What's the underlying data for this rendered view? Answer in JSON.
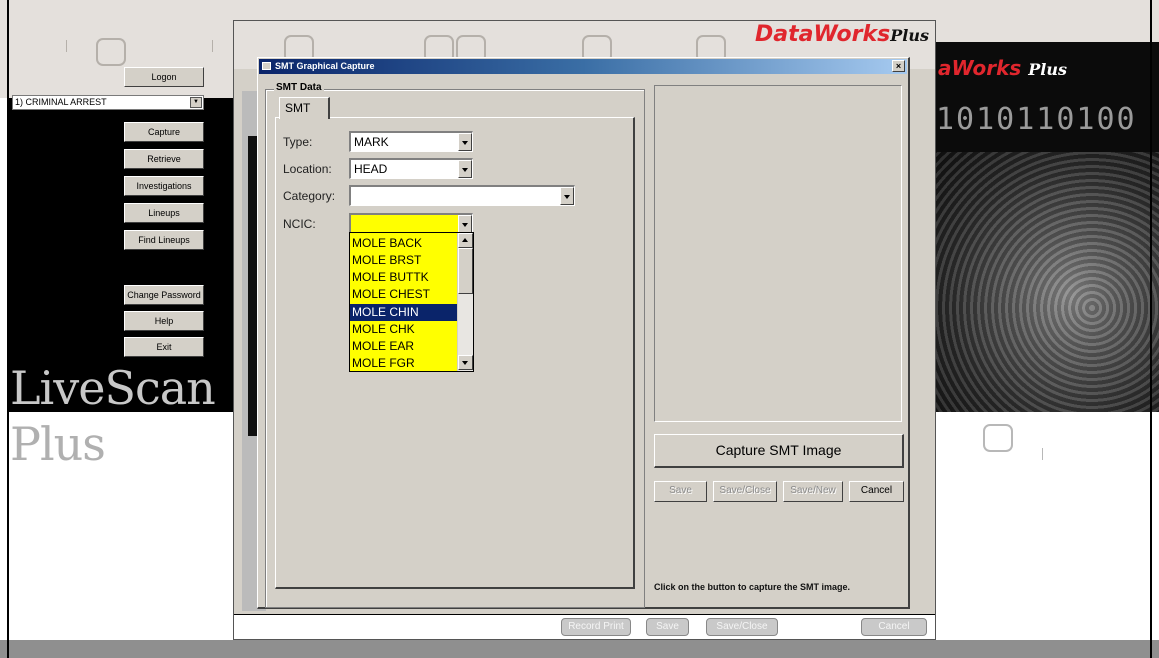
{
  "left_menu": {
    "logon": "Logon",
    "case_type": "1) CRIMINAL ARREST",
    "buttons": [
      "Capture",
      "Retrieve",
      "Investigations",
      "Lineups",
      "Find Lineups",
      "Change Password",
      "Help",
      "Exit"
    ]
  },
  "branding": {
    "livescan": "LiveScan",
    "plus": "Plus",
    "dataworks": "DataWorks",
    "dataworks_partial": "aWorks",
    "dataworks_plus": "Plus",
    "binary": "1010110100"
  },
  "bottom_bar": {
    "buttons": [
      "Record Print",
      "Save",
      "Save/Close",
      "Cancel"
    ]
  },
  "dialog": {
    "title": "SMT Graphical Capture",
    "close": "×",
    "group_title": "SMT Data",
    "tab": "SMT",
    "fields": {
      "type_label": "Type:",
      "type_value": "MARK",
      "location_label": "Location:",
      "location_value": "HEAD",
      "category_label": "Category:",
      "category_value": "",
      "ncic_label": "NCIC:",
      "ncic_value": ""
    },
    "ncic_options": [
      "MOLE BACK",
      "MOLE BRST",
      "MOLE BUTTK",
      "MOLE CHEST",
      "MOLE CHIN",
      "MOLE CHK",
      "MOLE EAR",
      "MOLE FGR"
    ],
    "ncic_selected": "MOLE CHIN",
    "capture_button": "Capture SMT Image",
    "action_buttons": {
      "save": "Save",
      "save_close": "Save/Close",
      "save_new": "Save/New",
      "cancel": "Cancel"
    },
    "hint": "Click on the button to capture the SMT image."
  },
  "colors": {
    "title_bar": "#0a246a",
    "ncic_highlight": "#ffff00",
    "selected_item": "#0a246a",
    "brand_red": "#e0262d"
  }
}
